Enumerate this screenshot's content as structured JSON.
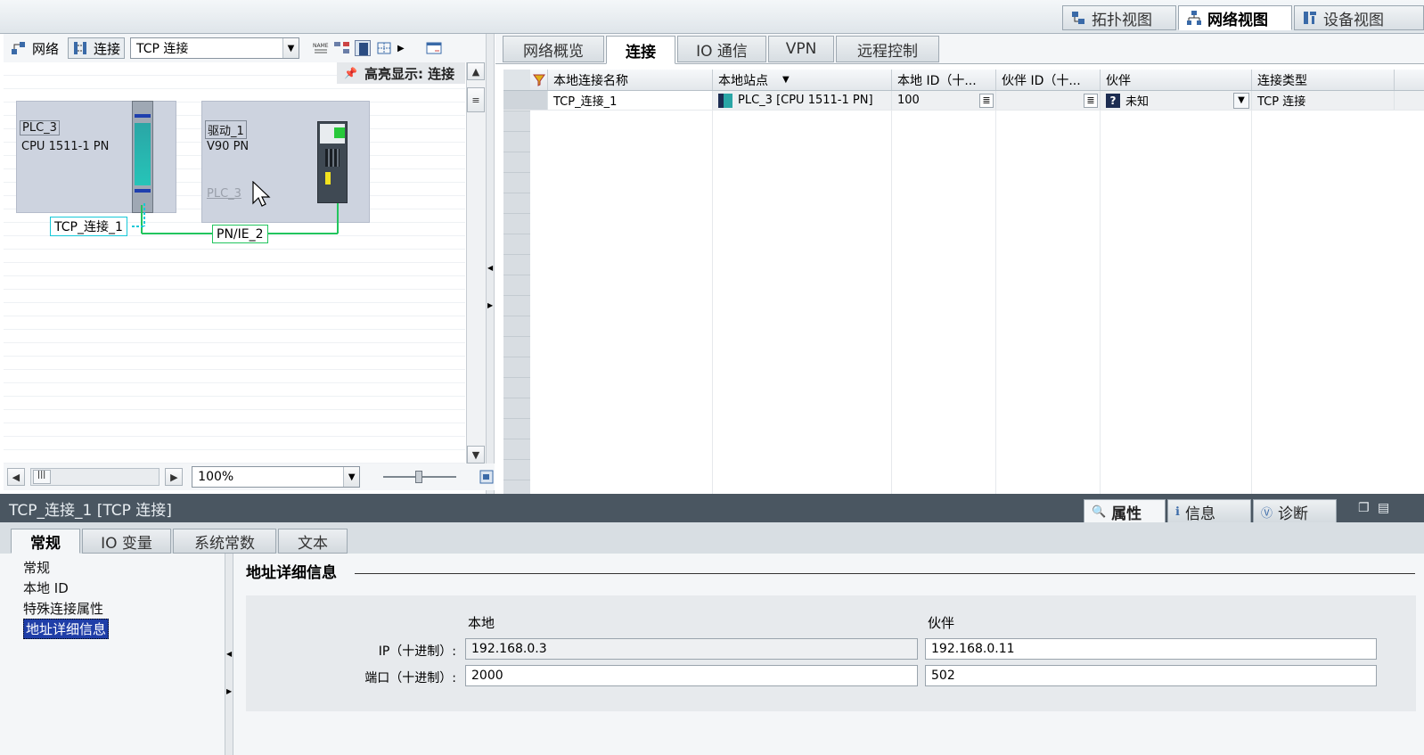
{
  "view_tabs": [
    {
      "label": "拓扑视图"
    },
    {
      "label": "网络视图"
    },
    {
      "label": "设备视图"
    }
  ],
  "left_toolbar": {
    "network_label": "网络",
    "connections_label": "连接",
    "connection_type_value": "TCP 连接"
  },
  "highlight_label": "高亮显示: 连接",
  "devices": [
    {
      "name": "PLC_3",
      "type": "CPU 1511-1 PN"
    },
    {
      "name": "驱动_1",
      "type": "V90 PN",
      "assigned": "PLC_3"
    }
  ],
  "connection_label": "TCP_连接_1",
  "subnet_label": "PN/IE_2",
  "zoom_value": "100%",
  "right_tabs": [
    "网络概览",
    "连接",
    "IO 通信",
    "VPN",
    "远程控制"
  ],
  "table": {
    "headers": [
      "本地连接名称",
      "本地站点",
      "本地 ID（十...",
      "伙伴 ID（十...",
      "伙伴",
      "连接类型"
    ],
    "rows": [
      {
        "name": "TCP_连接_1",
        "station": "PLC_3 [CPU 1511-1 PN]",
        "local_id": "100",
        "partner_id": "",
        "partner": "未知",
        "type": "TCP 连接"
      }
    ]
  },
  "inspector": {
    "title": "TCP_连接_1 [TCP 连接]",
    "tabs": [
      "属性",
      "信息",
      "诊断"
    ],
    "subtabs": [
      "常规",
      "IO 变量",
      "系统常数",
      "文本"
    ],
    "nav": [
      "常规",
      "本地 ID",
      "特殊连接属性",
      "地址详细信息"
    ],
    "section_title": "地址详细信息",
    "col_local": "本地",
    "col_partner": "伙伴",
    "rows": [
      {
        "label": "IP（十进制）:",
        "local": "192.168.0.3",
        "partner": "192.168.0.11"
      },
      {
        "label": "端口（十进制）:",
        "local": "2000",
        "partner": "502"
      }
    ]
  },
  "colors": {
    "accent_green": "#22c55e",
    "cyan": "#16c8d8",
    "selection": "#1f3ea8",
    "header_dark": "#4a5661"
  }
}
